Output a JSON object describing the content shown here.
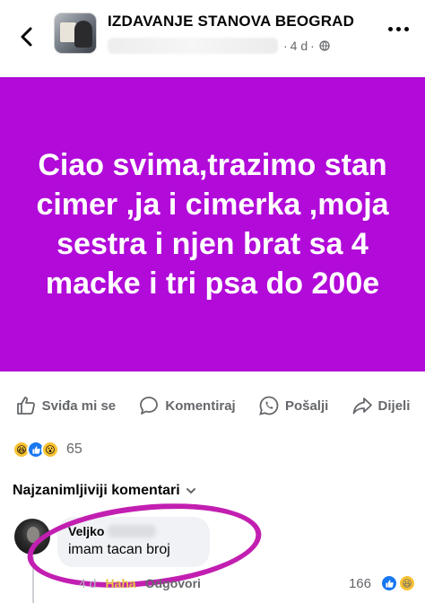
{
  "header": {
    "group_name": "IZDAVANJE STANOVA BEOGRAD",
    "time": "4 d",
    "separator": "·"
  },
  "post": {
    "text": "Ciao svima,trazimo stan cimer ,ja i cimerka ,moja sestra i njen brat sa 4 macke i tri psa do 200e",
    "background": "#b10ad9"
  },
  "actions": {
    "like": "Sviđa mi se",
    "comment": "Komentiraj",
    "send": "Pošalji",
    "share": "Dijeli"
  },
  "reactions": {
    "count": "65",
    "icons": [
      "haha-icon",
      "like-icon",
      "wow-icon"
    ]
  },
  "comments": {
    "filter_label": "Najzanimljiviji komentari",
    "items": [
      {
        "author": "Veljko",
        "text": "imam tacan broj",
        "time": "4 d",
        "like_label": "Haha",
        "reply_label": "Odgovori",
        "reaction_count": "166"
      }
    ]
  },
  "colors": {
    "accent": "#1877f2",
    "post_bg": "#b10ad9",
    "highlight": "#c21fb1"
  }
}
